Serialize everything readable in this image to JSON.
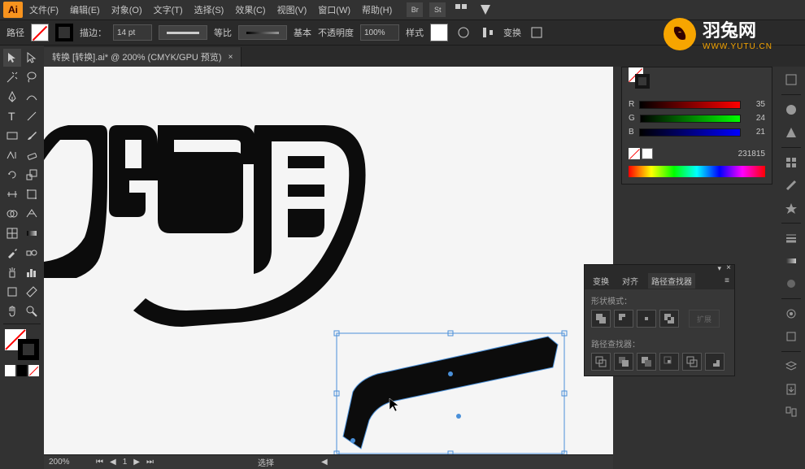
{
  "app": {
    "logo_text": "Ai"
  },
  "menu": {
    "file": "文件(F)",
    "edit": "编辑(E)",
    "object": "对象(O)",
    "type": "文字(T)",
    "select": "选择(S)",
    "effect": "效果(C)",
    "view": "视图(V)",
    "window": "窗口(W)",
    "help": "帮助(H)"
  },
  "menu_icons": {
    "br": "Br",
    "st": "St"
  },
  "options": {
    "path_label": "路径",
    "stroke_label": "描边：",
    "stroke_pt": "14 pt",
    "uniform_label": "等比",
    "basic_label": "基本",
    "opacity_label": "不透明度",
    "opacity_value": "100%",
    "style_label": "样式",
    "transform_label": "变换",
    "align_icon": "align-icon"
  },
  "document": {
    "tab_title": "转换  [转换].ai* @ 200% (CMYK/GPU 预览)",
    "close": "×"
  },
  "color_panel": {
    "r_label": "R",
    "r_val": "35",
    "g_label": "G",
    "g_val": "24",
    "b_label": "B",
    "b_val": "21",
    "hex": "231815"
  },
  "pathfinder": {
    "tab_transform": "变换",
    "tab_align": "对齐",
    "tab_pathfinder": "路径查找器",
    "shape_modes": "形状模式：",
    "pathfinders": "路径查找器："
  },
  "status": {
    "zoom": "200%",
    "artboard": "1",
    "tool": "选择"
  },
  "watermark": {
    "main": "羽兔网",
    "sub": "WWW.YUTU.CN"
  }
}
